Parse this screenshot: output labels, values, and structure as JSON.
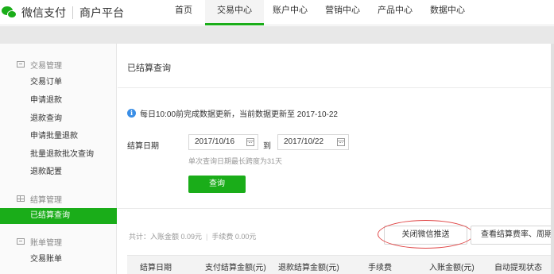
{
  "brand": {
    "name": "微信支付",
    "sub": "商户平台",
    "color": "#1aad19"
  },
  "nav": {
    "items": [
      {
        "label": "首页"
      },
      {
        "label": "交易中心"
      },
      {
        "label": "账户中心"
      },
      {
        "label": "营销中心"
      },
      {
        "label": "产品中心"
      },
      {
        "label": "数据中心"
      }
    ],
    "active": "交易中心"
  },
  "sidebar": {
    "groups": [
      {
        "label": "交易管理",
        "icon": "list-icon"
      },
      {
        "label": "结算管理",
        "icon": "grid-icon"
      },
      {
        "label": "账单管理",
        "icon": "list-icon"
      }
    ],
    "items": [
      {
        "label": "交易订单"
      },
      {
        "label": "申请退款"
      },
      {
        "label": "退款查询"
      },
      {
        "label": "申请批量退款"
      },
      {
        "label": "批量退款批次查询"
      },
      {
        "label": "退款配置"
      },
      {
        "label": "已结算查询"
      },
      {
        "label": "交易账单"
      }
    ],
    "active": "已结算查询"
  },
  "main": {
    "title": "已结算查询",
    "notice": "每日10:00前完成数据更新，当前数据更新至 2017-10-22",
    "date_label": "结算日期",
    "date_from": "2017/10/16",
    "date_to": "2017/10/22",
    "to_text": "到",
    "hint": "单次查询日期最长跨度为31天",
    "query_button": "查询",
    "summary": {
      "total_label": "共计：",
      "income": "入账金额 0.09元",
      "fee": "手续费 0.00元"
    },
    "close_push_button": "关闭微信推送",
    "rate_button": "查看结算费率、周期",
    "table_headers": [
      "结算日期",
      "支付结算金额(元)",
      "退款结算金额(元)",
      "手续费",
      "入账金额(元)",
      "自动提现状态"
    ]
  }
}
